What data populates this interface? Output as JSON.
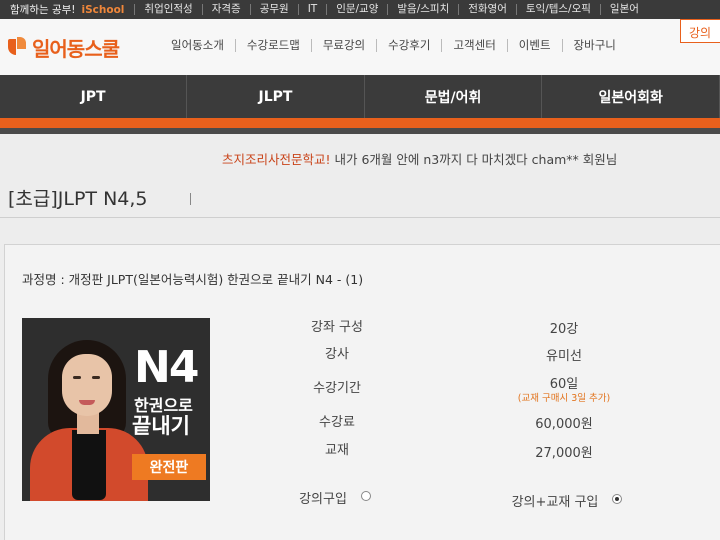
{
  "topbar": {
    "promo": "함께하는 공부!",
    "school": "iSchool",
    "items": [
      "취업인적성",
      "자격증",
      "공무원",
      "IT",
      "인문/교양",
      "발음/스피치",
      "전화영어",
      "토익/텝스/오픽",
      "일본어"
    ]
  },
  "header": {
    "logo": "일어동스쿨",
    "menu": [
      "일어동소개",
      "수강로드맵",
      "무료강의",
      "수강후기",
      "고객센터",
      "이벤트",
      "장바구니"
    ],
    "login_label": "강의"
  },
  "nav": {
    "items": [
      "JPT",
      "JLPT",
      "문법/어휘",
      "일본어회화"
    ]
  },
  "ticker": {
    "school": "츠지조리사전문학교!",
    "message": " 내가 6개월 안에 n3까지 다 마치겠다 cham** 회원님"
  },
  "page_title": "[초급]JLPT N4,5",
  "course": {
    "name": "과정명 : 개정판 JLPT(일본어능력시험) 한권으로 끝내기 N4 - (1)",
    "image": {
      "big": "N4",
      "line1": "한권으로",
      "line2": "끝내기",
      "badge": "완전판"
    },
    "rows": [
      {
        "label": "강좌 구성",
        "value": "20강"
      },
      {
        "label": "강사",
        "value": "유미선"
      },
      {
        "label": "수강기간",
        "value": "60일",
        "note": "(교재 구매시 3일 추가)"
      },
      {
        "label": "수강료",
        "value": "60,000원"
      },
      {
        "label": "교재",
        "value": "27,000원"
      }
    ],
    "options": [
      {
        "label": "강의구입",
        "checked": false
      },
      {
        "label": "강의+교재 구입",
        "checked": true
      }
    ]
  }
}
